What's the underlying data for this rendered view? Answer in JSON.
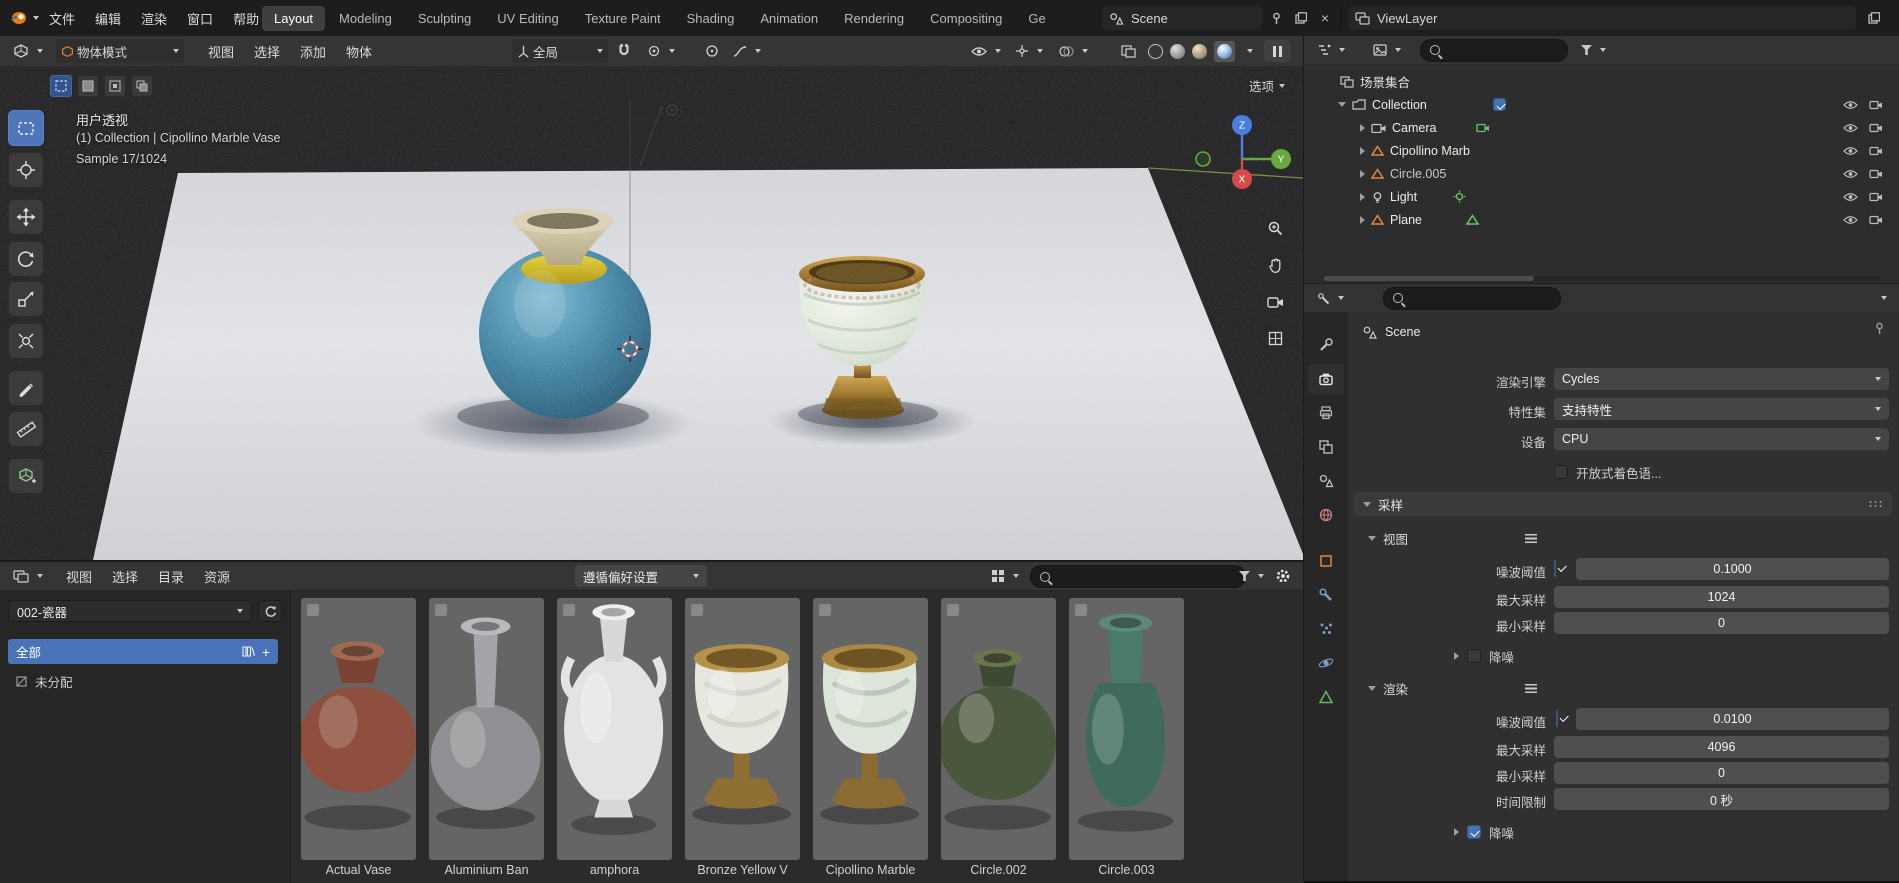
{
  "colors": {
    "accent": "#4772b3",
    "active_tool": "#4f76b8",
    "catalog_selected": "#4a72b8",
    "thumb_bg": "#656565",
    "checkbox_on": "#4772b3"
  },
  "topbar": {
    "menus": [
      "文件",
      "编辑",
      "渲染",
      "窗口",
      "帮助"
    ],
    "workspaces": [
      "Layout",
      "Modeling",
      "Sculpting",
      "UV Editing",
      "Texture Paint",
      "Shading",
      "Animation",
      "Rendering",
      "Compositing",
      "Ge"
    ],
    "scene": {
      "label": "Scene"
    },
    "viewlayer": {
      "label": "ViewLayer"
    }
  },
  "toolbar": {
    "mode": "物体模式",
    "menus": [
      "视图",
      "选择",
      "添加",
      "物体"
    ],
    "orientation": "全局"
  },
  "tools": {
    "items": [
      "box-select",
      "cursor",
      "move",
      "rotate",
      "scale",
      "transform",
      "annotate",
      "measure",
      "add-cube"
    ]
  },
  "viewport": {
    "overlay": {
      "line1": "用户透视",
      "line2": "(1) Collection | Cipollino Marble Vase",
      "line3": "Sample 17/1024"
    },
    "options": "选项",
    "gizmo": {
      "z": "Z",
      "y": "Y",
      "x": "X"
    }
  },
  "outliner": {
    "root": "场景集合",
    "collection": "Collection",
    "items": [
      {
        "label": "Camera",
        "type": "camera"
      },
      {
        "label": "Cipollino Marb",
        "type": "mesh"
      },
      {
        "label": "Circle.005",
        "type": "mesh"
      },
      {
        "label": "Light",
        "type": "light"
      },
      {
        "label": "Plane",
        "type": "mesh"
      }
    ]
  },
  "properties": {
    "tabs": [
      "tool",
      "render",
      "output",
      "view-layer",
      "scene",
      "world",
      "object",
      "modifiers",
      "particles",
      "physics",
      "object-data"
    ],
    "context": "Scene",
    "engine_label": "渲染引擎",
    "engine": "Cycles",
    "featureset_label": "特性集",
    "featureset": "支持特性",
    "device_label": "设备",
    "device": "CPU",
    "osl": "开放式着色语...",
    "sampling": "采样",
    "viewport_panel": {
      "title": "视图",
      "noise_label": "噪波阈值",
      "noise": "0.1000",
      "max_label": "最大采样",
      "max": "1024",
      "min_label": "最小采样",
      "min": "0",
      "denoise": "降噪"
    },
    "render_panel": {
      "title": "渲染",
      "noise_label": "噪波阈值",
      "noise": "0.0100",
      "max_label": "最大采样",
      "max": "4096",
      "min_label": "最小采样",
      "min": "0",
      "time_label": "时间限制",
      "time": "0 秒",
      "denoise": "降噪"
    }
  },
  "assets": {
    "menus": [
      "视图",
      "选择",
      "目录",
      "资源"
    ],
    "import_method": "遵循偏好设置",
    "catalog": "002-瓷器",
    "catalogs": [
      {
        "label": "全部"
      },
      {
        "label": "未分配"
      }
    ],
    "items": [
      {
        "label": "Actual Vase",
        "body": "#8e4f3e",
        "neck": "#7a4232",
        "rim": "#a06a52"
      },
      {
        "label": "Aluminium Ban",
        "body": "#8f9093",
        "neck": "#a4a5a8",
        "rim": "#b8b9bc"
      },
      {
        "label": "amphora",
        "body": "#e3e2e4",
        "neck": "#d8d7d9",
        "rim": "#efeef0"
      },
      {
        "label": "Bronze Yellow V",
        "body": "#e7e6df",
        "neck": "#8f6f33",
        "rim": "#b5924a"
      },
      {
        "label": "Cipollino Marble",
        "body": "#dde5da",
        "neck": "#8a6c32",
        "rim": "#ad8a43"
      },
      {
        "label": "Circle.002",
        "body": "#49573c",
        "neck": "#3c4a31",
        "rim": "#6a744f"
      },
      {
        "label": "Circle.003",
        "body": "#3f6b5c",
        "neck": "#4a7a69",
        "rim": "#5d8a77"
      }
    ]
  }
}
